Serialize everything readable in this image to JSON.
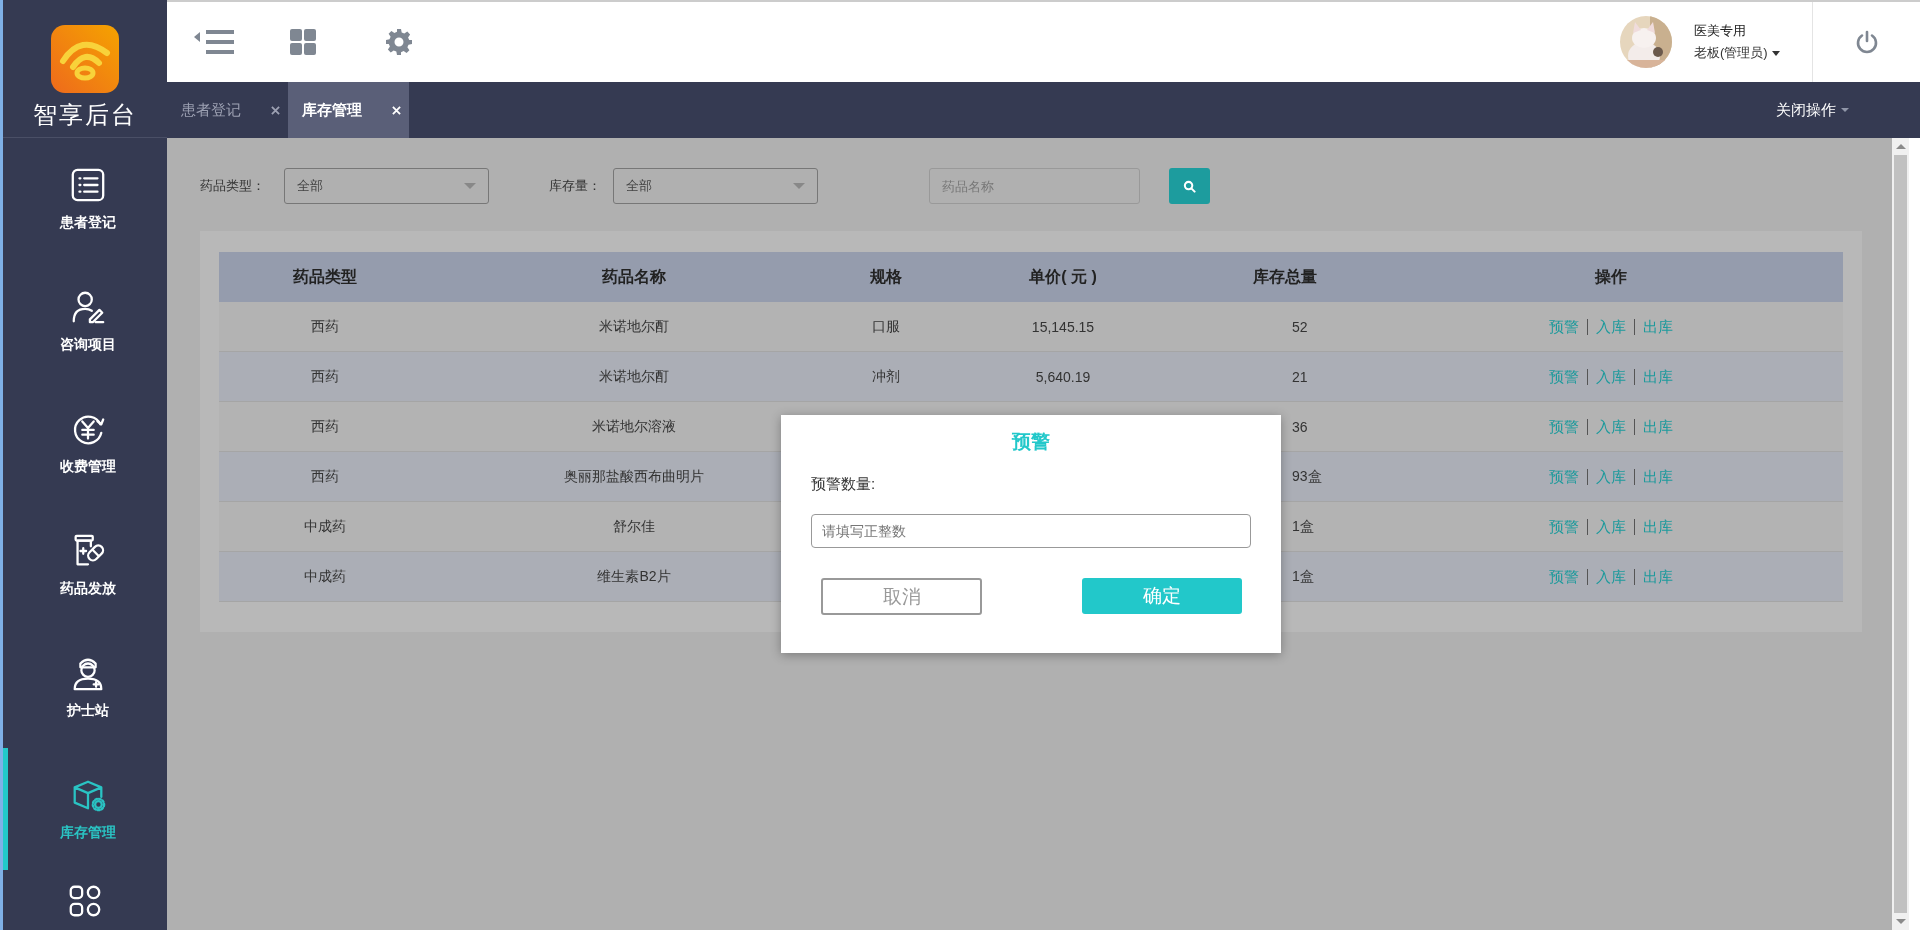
{
  "logo": {
    "text": "智享后台"
  },
  "sidebar": {
    "items": [
      {
        "label": "患者登记",
        "selected": false
      },
      {
        "label": "咨询项目",
        "selected": false
      },
      {
        "label": "收费管理",
        "selected": false
      },
      {
        "label": "药品发放",
        "selected": false
      },
      {
        "label": "护士站",
        "selected": false
      },
      {
        "label": "库存管理",
        "selected": true
      }
    ]
  },
  "header": {
    "user_name": "医美专用",
    "user_role": "老板(管理员)"
  },
  "tabs": [
    {
      "label": "患者登记",
      "selected": false
    },
    {
      "label": "库存管理",
      "selected": true
    }
  ],
  "tab_menu": "关闭操作",
  "filters": {
    "type_label": "药品类型：",
    "type_value": "全部",
    "stock_label": "库存量：",
    "stock_value": "全部",
    "search_placeholder": "药品名称"
  },
  "table": {
    "columns": [
      "药品类型",
      "药品名称",
      "规格",
      "单价( 元 )",
      "库存总量",
      "操作"
    ],
    "rows": [
      {
        "type": "西药",
        "name": "米诺地尔酊",
        "spec": "口服",
        "price": "15,145.15",
        "stock": "52",
        "actions": [
          "预警",
          "入库",
          "出库"
        ]
      },
      {
        "type": "西药",
        "name": "米诺地尔酊",
        "spec": "冲剂",
        "price": "5,640.19",
        "stock": "21",
        "actions": [
          "预警",
          "入库",
          "出库"
        ]
      },
      {
        "type": "西药",
        "name": "米诺地尔溶液",
        "stock": "36",
        "actions": [
          "预警",
          "入库",
          "出库"
        ]
      },
      {
        "type": "西药",
        "name": "奥丽那盐酸西布曲明片",
        "stock": "93盒",
        "actions": [
          "预警",
          "入库",
          "出库"
        ]
      },
      {
        "type": "中成药",
        "name": "舒尔佳",
        "stock": "1盒",
        "actions": [
          "预警",
          "入库",
          "出库"
        ]
      },
      {
        "type": "中成药",
        "name": "维生素B2片",
        "stock": "1盒",
        "actions": [
          "预警",
          "入库",
          "出库"
        ]
      }
    ]
  },
  "dialog": {
    "title": "预警",
    "label": "预警数量:",
    "placeholder": "请填写正整数",
    "cancel": "取消",
    "confirm": "确定"
  }
}
